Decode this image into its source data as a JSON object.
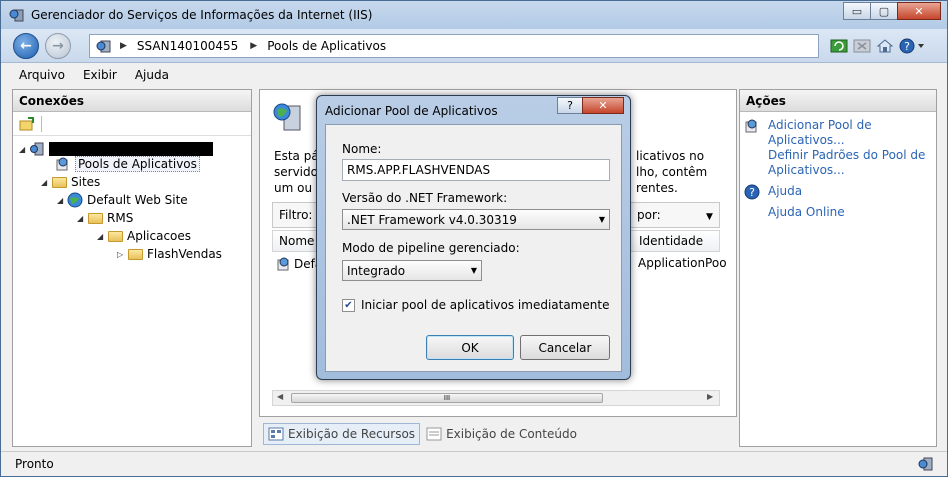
{
  "window": {
    "title": "Gerenciador do Serviços de Informações da Internet (IIS)",
    "minimize": "▭",
    "maximize": "▢",
    "close": "✕"
  },
  "address": {
    "crumbs": [
      "SSAN140100455",
      "Pools de Aplicativos"
    ]
  },
  "menu": [
    "Arquivo",
    "Exibir",
    "Ajuda"
  ],
  "connections": {
    "header": "Conexões",
    "tree": [
      {
        "label": "Pools de Aplicativos"
      },
      {
        "label": "Sites"
      },
      {
        "label": "Default Web Site"
      },
      {
        "label": "RMS"
      },
      {
        "label": "Aplicacoes"
      },
      {
        "label": "FlashVendas"
      }
    ]
  },
  "center": {
    "text_left": [
      "Esta pág",
      "servidor",
      "um ou m"
    ],
    "text_right": [
      "licativos no",
      "lho, contêm",
      "rentes."
    ],
    "filter_label": "Filtro:",
    "filter_right": "por:",
    "col_name": "Nome",
    "col_identity": "Identidade",
    "row_name": "Defa",
    "row_identity": "ApplicationPoo",
    "scroll_grip": "III"
  },
  "tabs": {
    "features": "Exibição de Recursos",
    "content": "Exibição de Conteúdo"
  },
  "actions": {
    "header": "Ações",
    "add_pool_1": "Adicionar Pool de",
    "add_pool_2": "Aplicativos...",
    "defaults_1": "Definir Padrões do Pool de",
    "defaults_2": "Aplicativos...",
    "help": "Ajuda",
    "help_online": "Ajuda Online"
  },
  "status": {
    "text": "Pronto"
  },
  "dialog": {
    "title": "Adicionar Pool de Aplicativos",
    "help_btn": "?",
    "close_btn": "✕",
    "name_label": "Nome:",
    "name_value": "RMS.APP.FLASHVENDAS",
    "framework_label": "Versão do .NET Framework:",
    "framework_value": ".NET Framework v4.0.30319",
    "pipeline_label": "Modo de pipeline gerenciado:",
    "pipeline_value": "Integrado",
    "start_checked": true,
    "start_label": "Iniciar pool de aplicativos imediatamente",
    "ok": "OK",
    "cancel": "Cancelar"
  }
}
